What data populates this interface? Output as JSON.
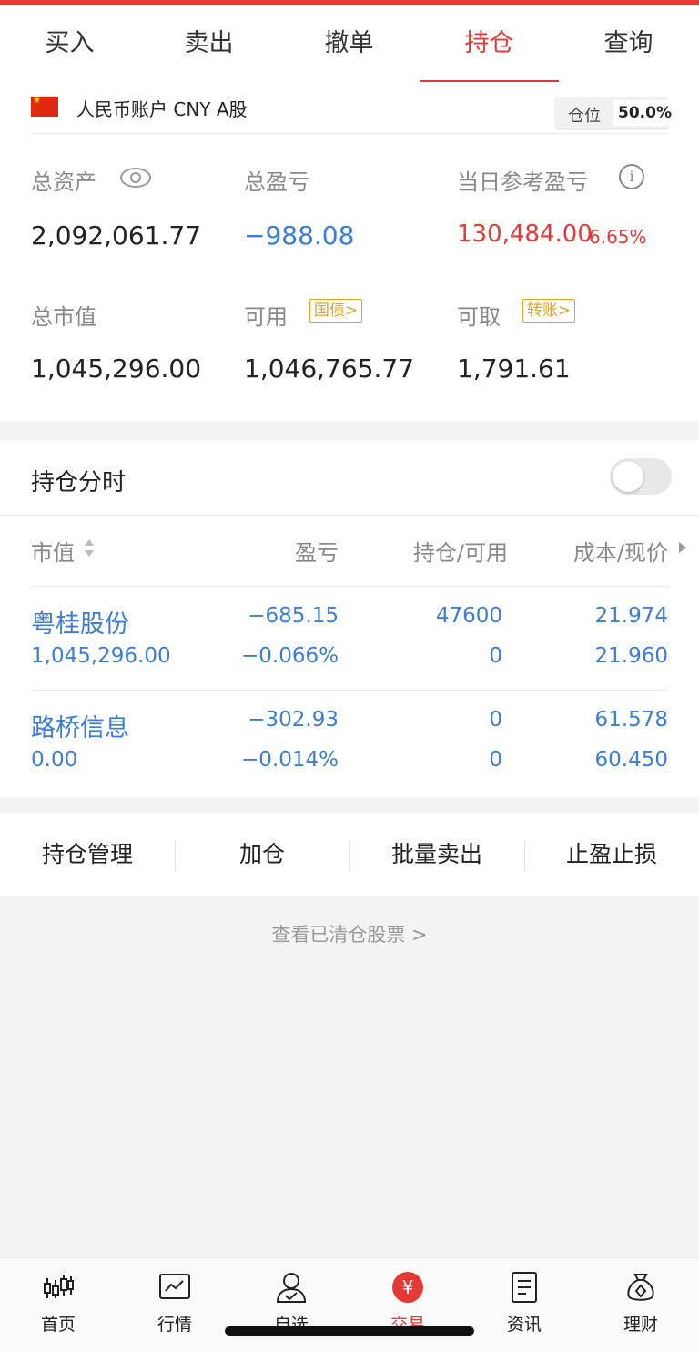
{
  "tabs": [
    {
      "label": "买入"
    },
    {
      "label": "卖出"
    },
    {
      "label": "撤单"
    },
    {
      "label": "持仓",
      "active": true
    },
    {
      "label": "查询"
    }
  ],
  "account": {
    "name": "人民币账户 CNY A股",
    "position_label": "仓位",
    "position_value": "50.0%",
    "total_assets_label": "总资产",
    "total_assets": "2,092,061.77",
    "total_pl_label": "总盈亏",
    "total_pl": "−988.08",
    "daily_pl_label": "当日参考盈亏",
    "daily_pl": "130,484.00",
    "daily_pl_pct": "6.65%",
    "market_value_label": "总市值",
    "market_value": "1,045,296.00",
    "available_label": "可用",
    "available_tag": "国债>",
    "available": "1,046,765.77",
    "withdrawable_label": "可取",
    "withdrawable_tag": "转账>",
    "withdrawable": "1,791.61"
  },
  "holdings": {
    "title": "持仓分时",
    "toggle_on": false,
    "columns": [
      "市值",
      "盈亏",
      "持仓/可用",
      "成本/现价"
    ],
    "rows": [
      {
        "name": "粤桂股份",
        "market_value": "1,045,296.00",
        "pl": "−685.15",
        "pl_pct": "−0.066%",
        "qty": "47600",
        "avail": "0",
        "cost": "21.974",
        "price": "21.960"
      },
      {
        "name": "路桥信息",
        "market_value": "0.00",
        "pl": "−302.93",
        "pl_pct": "−0.014%",
        "qty": "0",
        "avail": "0",
        "cost": "61.578",
        "price": "60.450"
      }
    ]
  },
  "actions": [
    "持仓管理",
    "加仓",
    "批量卖出",
    "止盈止损"
  ],
  "cleared_link": "查看已清仓股票 >",
  "bottom_nav": [
    {
      "label": "首页",
      "icon": "candlestick-icon"
    },
    {
      "label": "行情",
      "icon": "chart-icon"
    },
    {
      "label": "自选",
      "icon": "user-check-icon"
    },
    {
      "label": "交易",
      "icon": "yuan-icon",
      "active": true
    },
    {
      "label": "资讯",
      "icon": "document-icon"
    },
    {
      "label": "理财",
      "icon": "money-bag-icon"
    }
  ],
  "colors": {
    "accent": "#e53935",
    "blue": "#3b7dd8",
    "orange": "#e9a21a"
  }
}
